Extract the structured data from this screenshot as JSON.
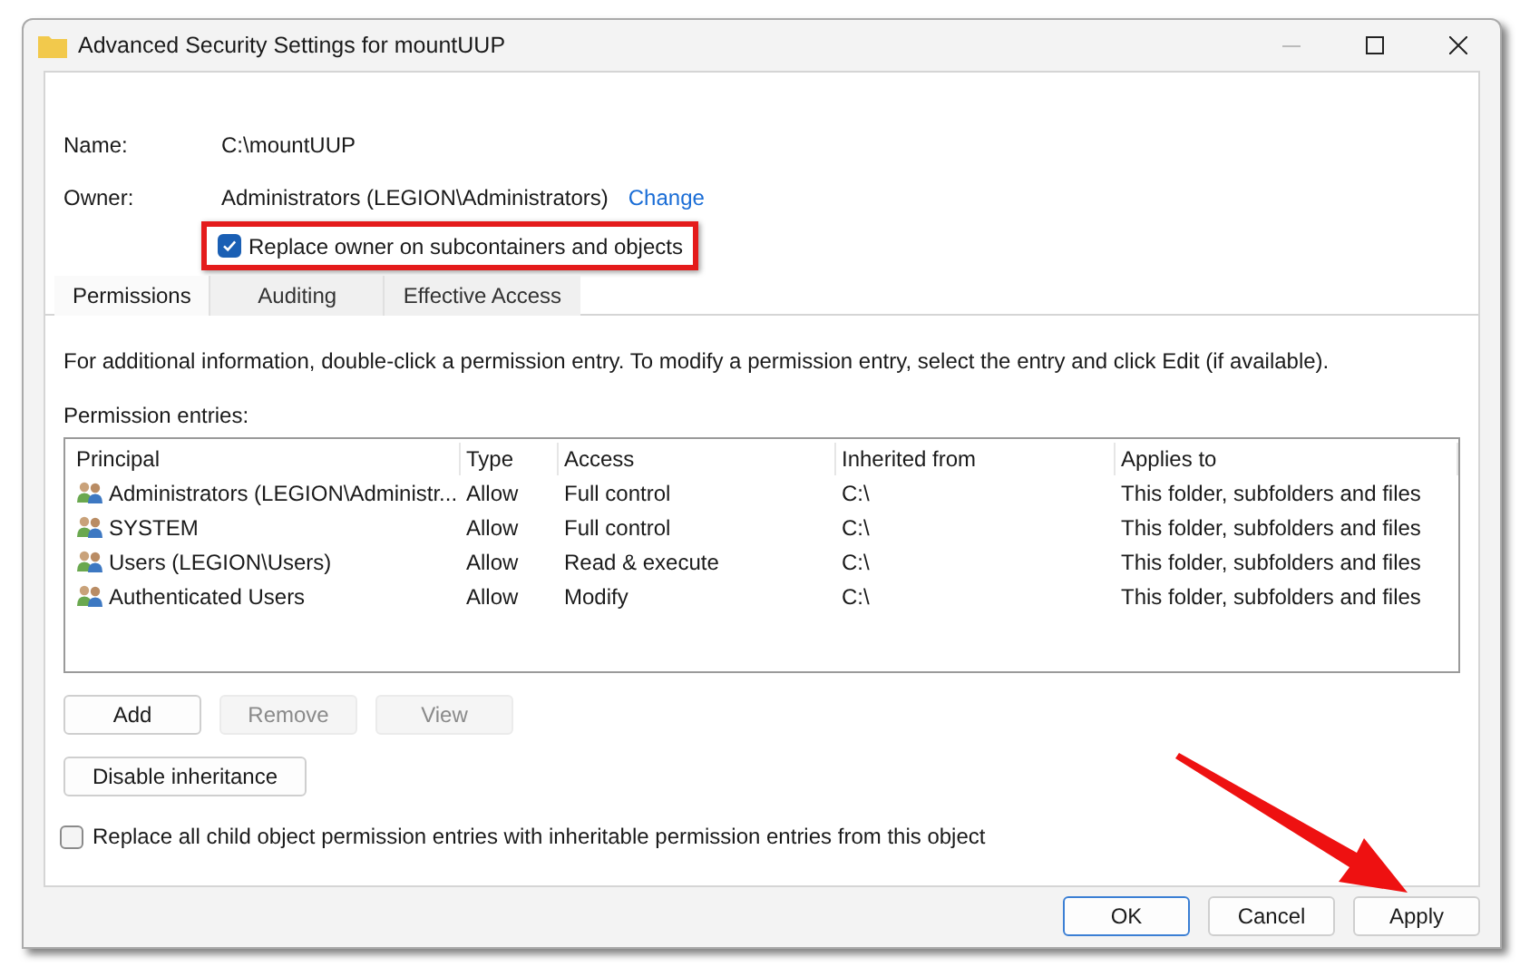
{
  "window": {
    "title": "Advanced Security Settings for mountUUP"
  },
  "fields": [
    {
      "label": "Name:",
      "value": "C:\\mountUUP"
    },
    {
      "label": "Owner:",
      "value": "Administrators (LEGION\\Administrators)",
      "link": "Change"
    }
  ],
  "replace_owner": {
    "label": "Replace owner on subcontainers and objects",
    "checked": true
  },
  "tabs": [
    {
      "label": "Permissions",
      "selected": true
    },
    {
      "label": "Auditing",
      "selected": false
    },
    {
      "label": "Effective Access",
      "selected": false
    }
  ],
  "info": "For additional information, double-click a permission entry. To modify a permission entry, select the entry and click Edit (if available).",
  "entries_label": "Permission entries:",
  "table": {
    "columns": [
      "Principal",
      "Type",
      "Access",
      "Inherited from",
      "Applies to"
    ],
    "rows": [
      [
        "Administrators (LEGION\\Administr...",
        "Allow",
        "Full control",
        "C:\\",
        "This folder, subfolders and files"
      ],
      [
        "SYSTEM",
        "Allow",
        "Full control",
        "C:\\",
        "This folder, subfolders and files"
      ],
      [
        "Users (LEGION\\Users)",
        "Allow",
        "Read & execute",
        "C:\\",
        "This folder, subfolders and files"
      ],
      [
        "Authenticated Users",
        "Allow",
        "Modify",
        "C:\\",
        "This folder, subfolders and files"
      ]
    ]
  },
  "entry_buttons": [
    {
      "label": "Add",
      "disabled": false
    },
    {
      "label": "Remove",
      "disabled": true
    },
    {
      "label": "View",
      "disabled": true
    }
  ],
  "inheritance_button": "Disable inheritance",
  "replace_child": {
    "label": "Replace all child object permission entries with inheritable permission entries from this object",
    "checked": false
  },
  "footer_buttons": [
    {
      "label": "OK",
      "default": true
    },
    {
      "label": "Cancel",
      "default": false
    },
    {
      "label": "Apply",
      "default": false
    }
  ]
}
